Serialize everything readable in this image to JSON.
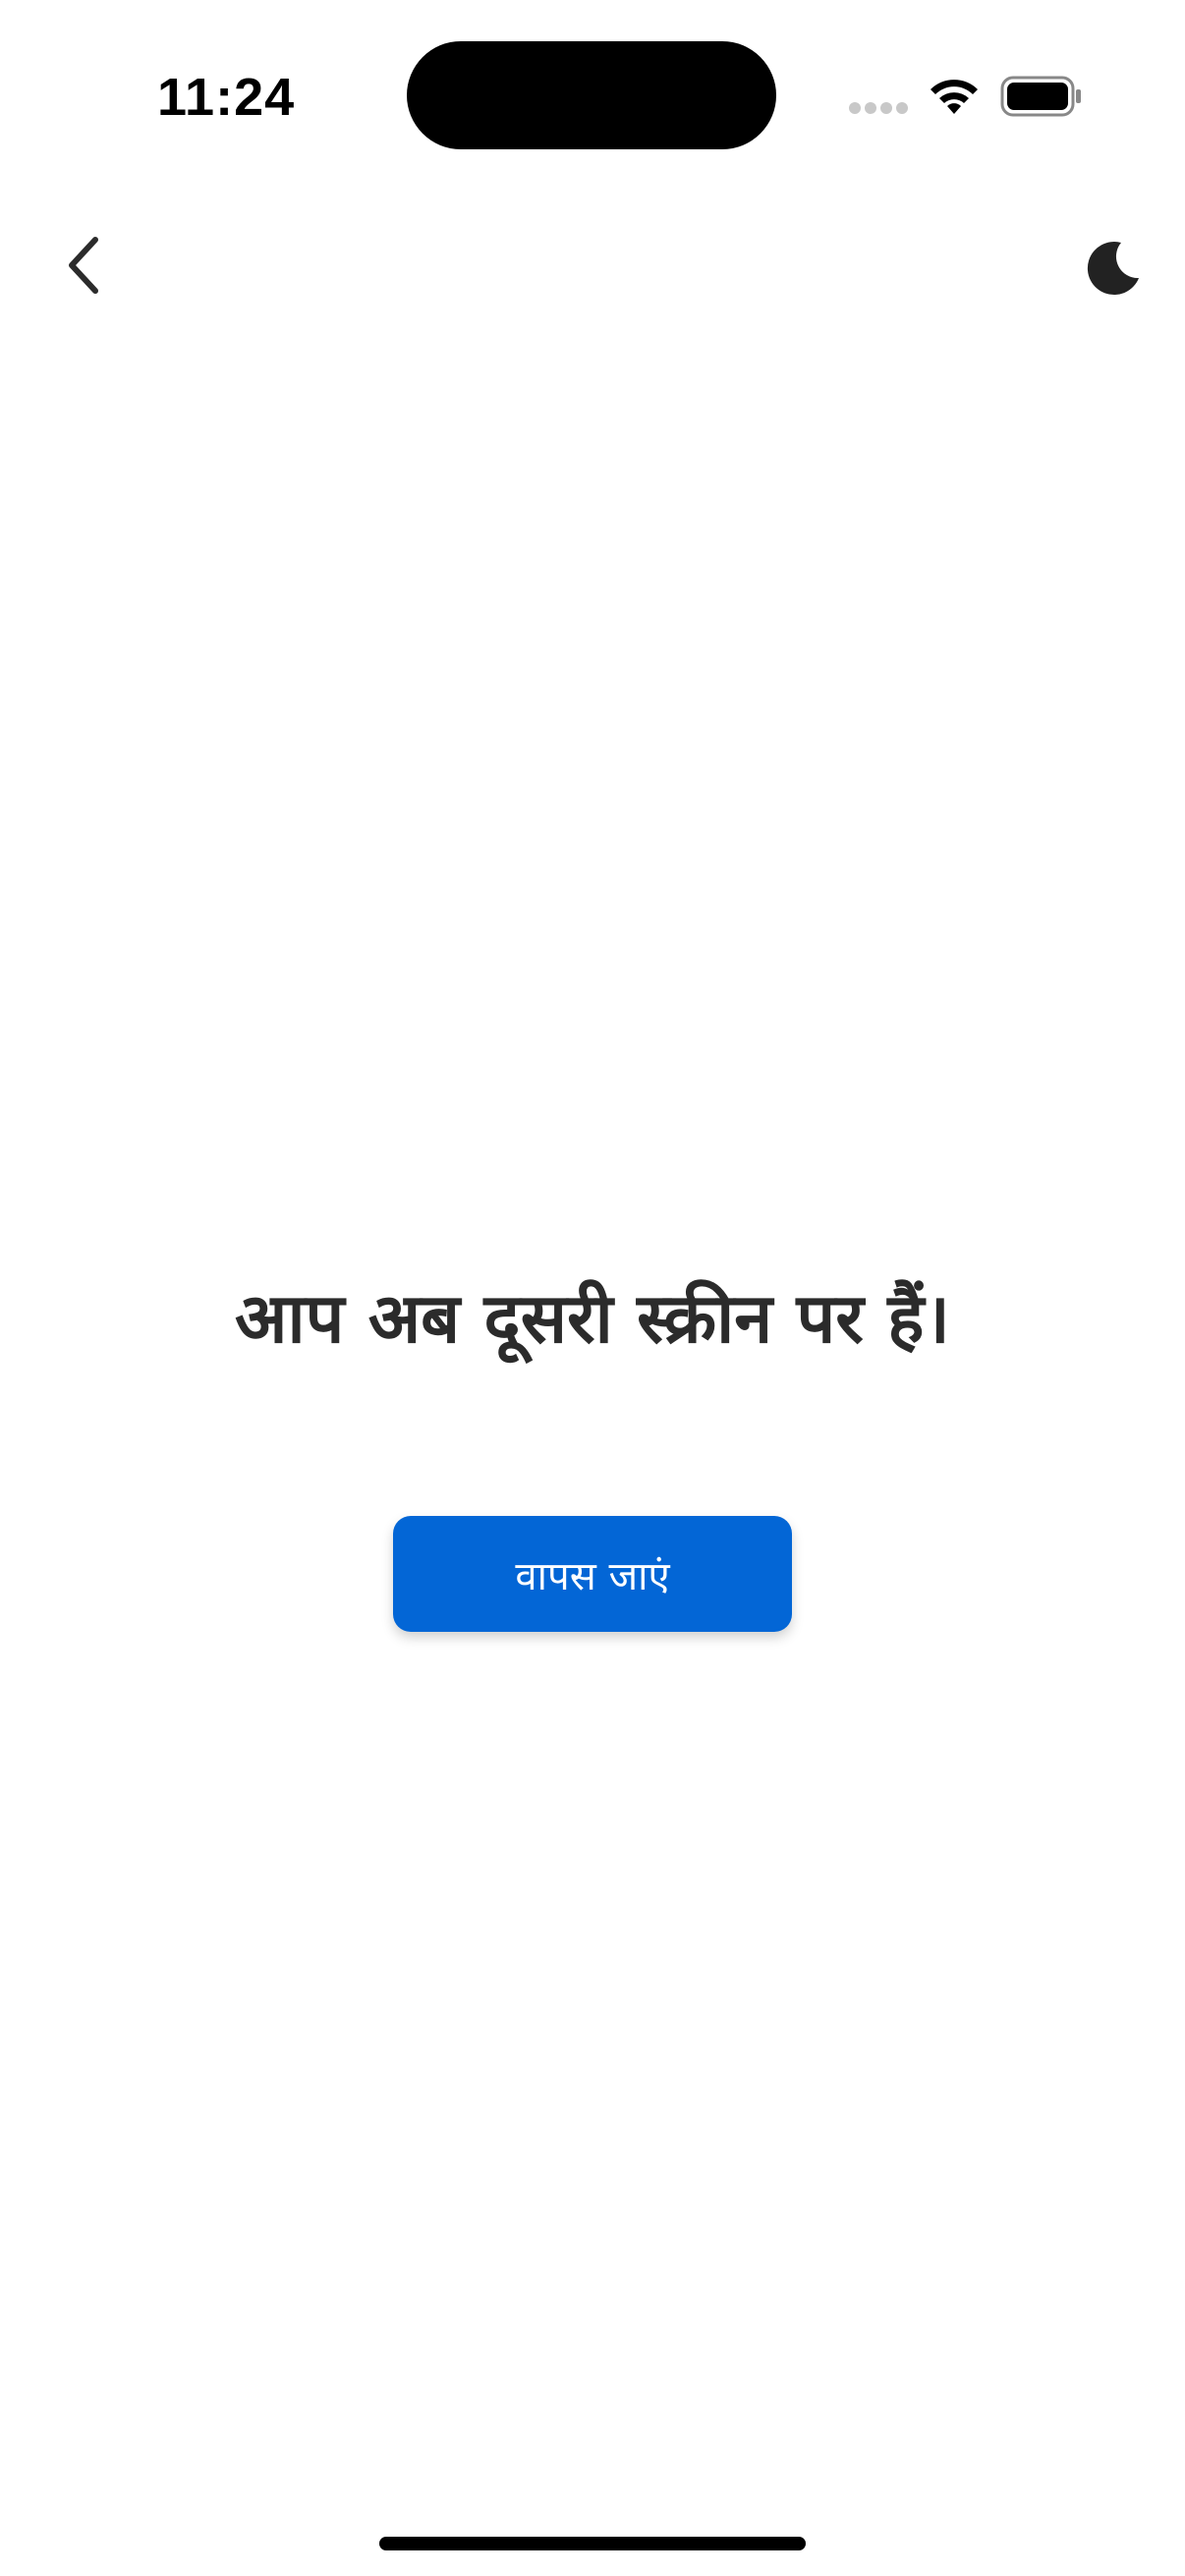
{
  "status_bar": {
    "time": "11:24",
    "signal_icon": "signal-icon",
    "wifi_icon": "wifi-icon",
    "battery_icon": "battery-icon"
  },
  "nav": {
    "back_icon": "chevron-left-icon",
    "theme_icon": "moon-icon"
  },
  "main": {
    "message": "आप अब दूसरी स्क्रीन पर हैं।",
    "back_button_label": "वापस जाएं"
  },
  "colors": {
    "background": "#ffffff",
    "text": "#2b2b2b",
    "button_bg": "#0366d6",
    "button_text": "#ffffff"
  }
}
